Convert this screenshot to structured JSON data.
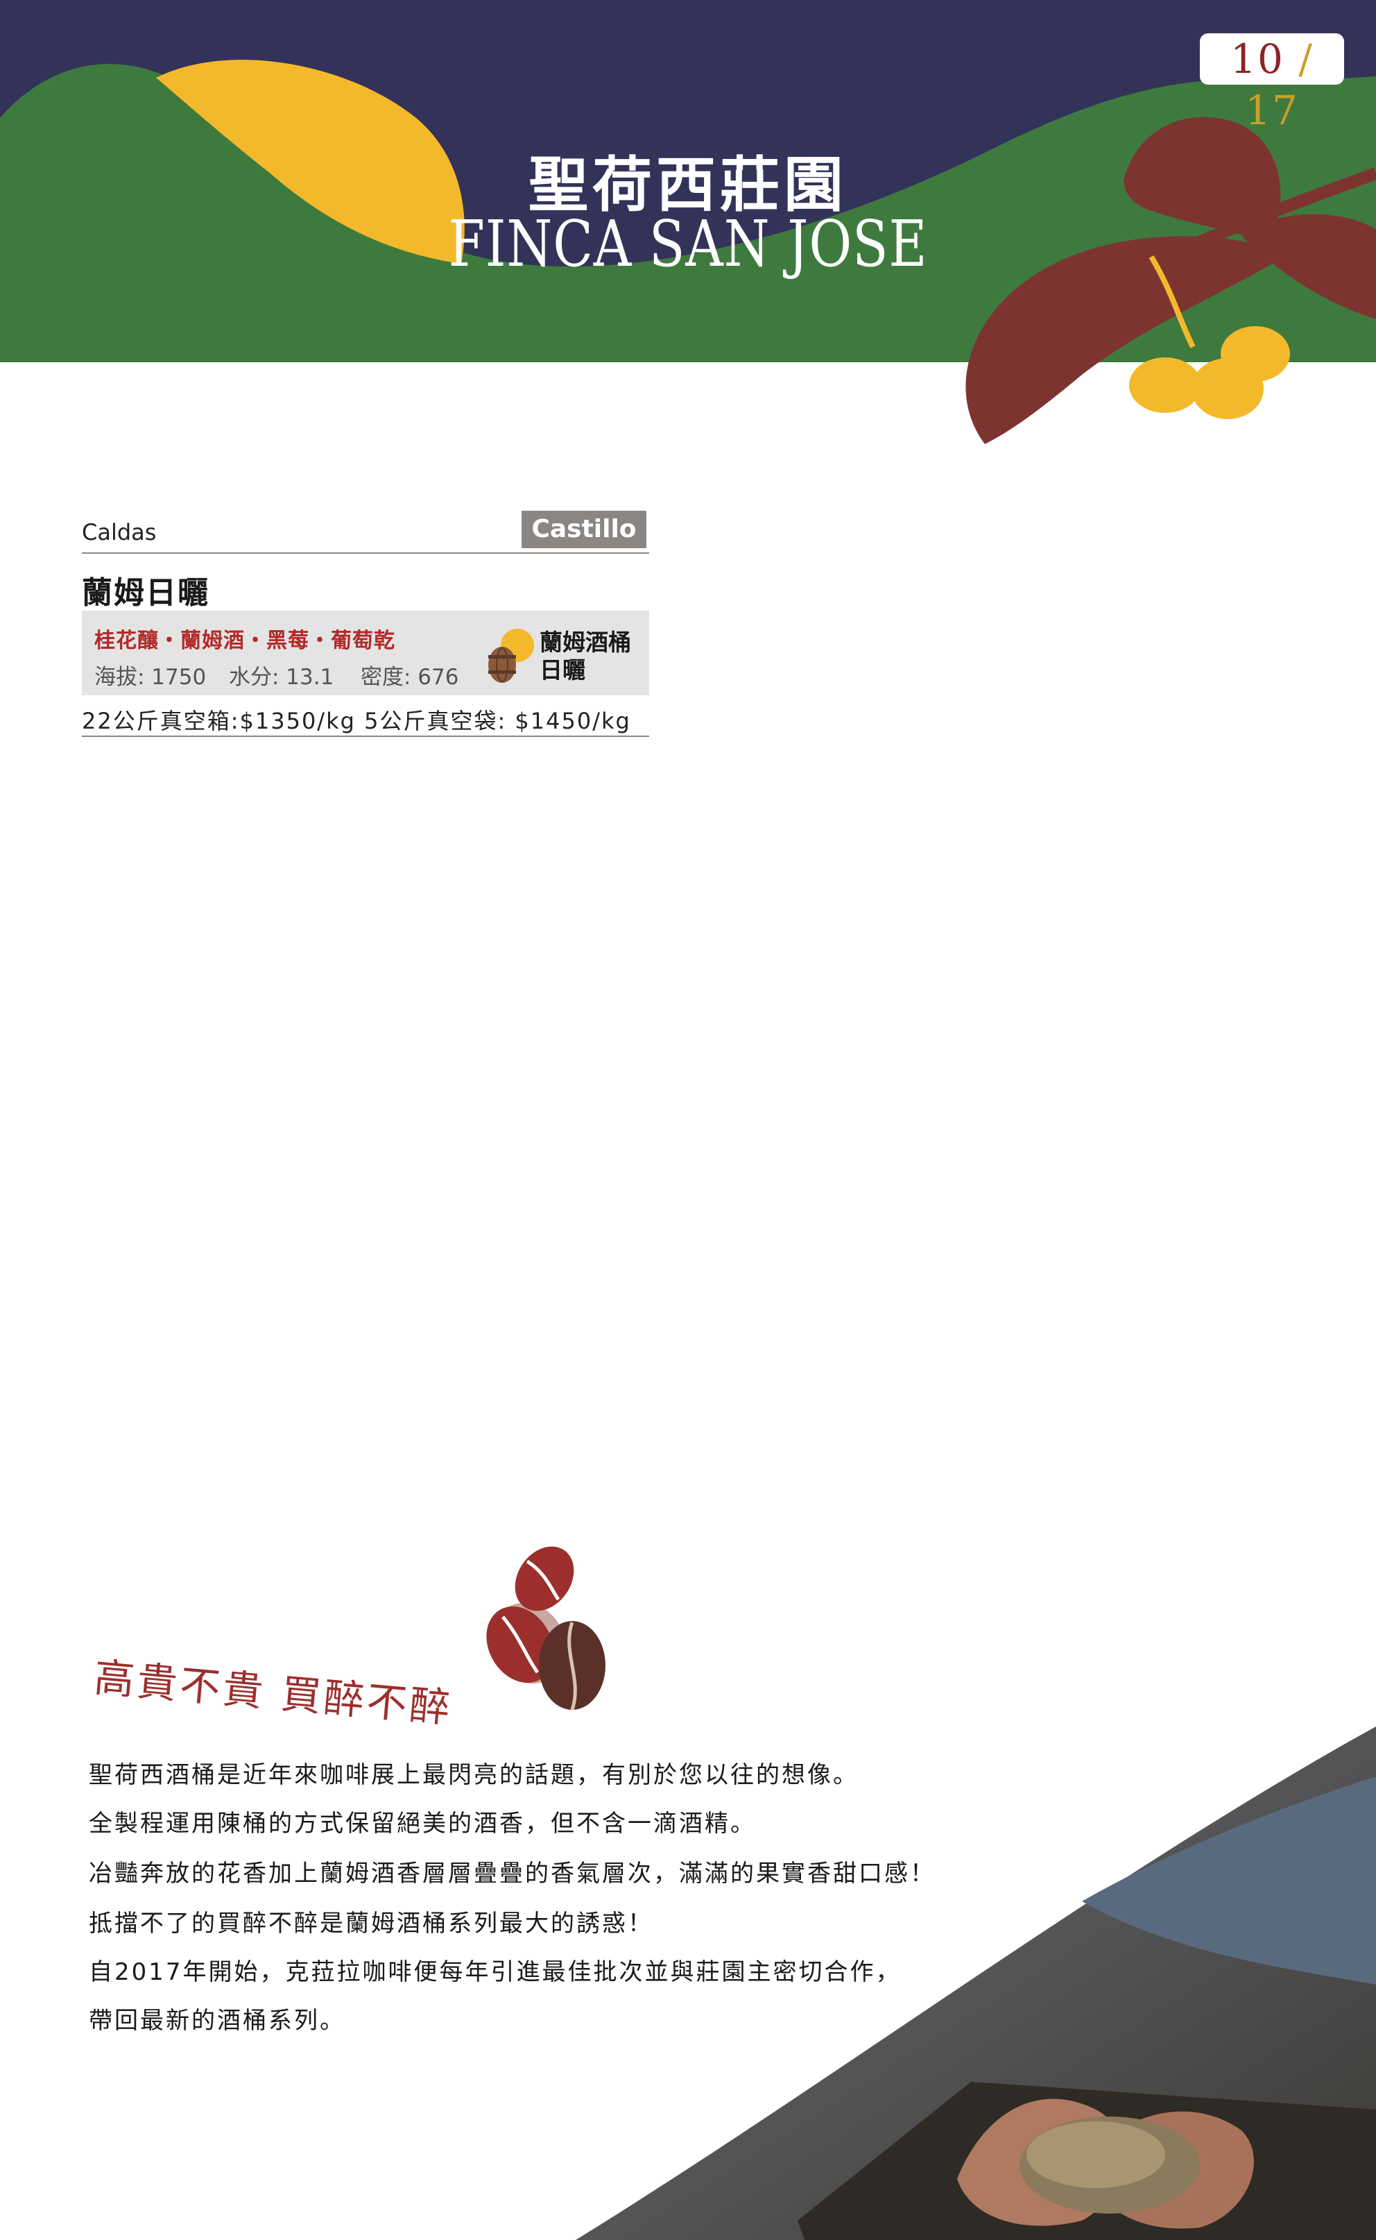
{
  "header": {
    "page_current": "10",
    "page_separator": "/",
    "page_total": "17",
    "title_zh": "聖荷西莊園",
    "title_en": "FINCA SAN JOSE"
  },
  "product": {
    "region": "Caldas",
    "variety": "Castillo",
    "name": "蘭姆日曬",
    "flavor_notes": "桂花釀・蘭姆酒・黑莓・葡萄乾",
    "altitude": "海拔: 1750",
    "moisture": "水分: 13.1",
    "density": "密度: 676",
    "process_line1": "蘭姆酒桶",
    "process_line2": "日曬",
    "pricing": "22公斤真空箱:$1350/kg  5公斤真空袋: $1450/kg"
  },
  "story": {
    "slogan": "高貴不貴 買醉不醉",
    "paragraphs": [
      "聖荷西酒桶是近年來咖啡展上最閃亮的話題，有別於您以往的想像。",
      "全製程運用陳桶的方式保留絕美的酒香，但不含一滴酒精。",
      "冶豔奔放的花香加上蘭姆酒香層層疊疊的香氣層次，滿滿的果實香甜口感！",
      "抵擋不了的買醉不醉是蘭姆酒桶系列最大的誘惑！",
      "自2017年開始，克菈拉咖啡便每年引進最佳批次並與莊園主密切合作，",
      "帶回最新的酒桶系列。"
    ]
  },
  "colors": {
    "navy": "#33335a",
    "green": "#3e7a3e",
    "yellow": "#f4b92a",
    "maroon": "#7d3431",
    "accent_red": "#b32a28"
  }
}
